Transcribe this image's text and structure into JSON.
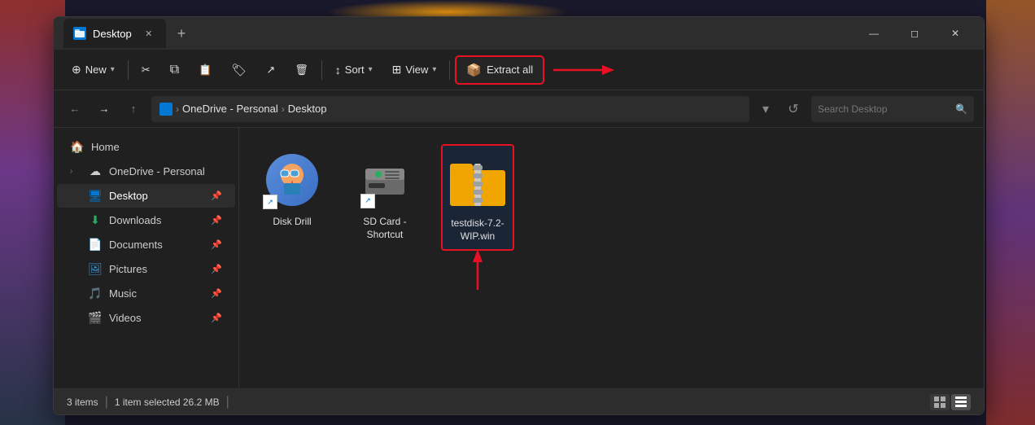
{
  "window": {
    "title": "Desktop",
    "tab_label": "Desktop",
    "new_tab_tooltip": "New tab"
  },
  "toolbar": {
    "new_label": "New",
    "sort_label": "Sort",
    "view_label": "View",
    "extract_all_label": "Extract all",
    "cut_tooltip": "Cut",
    "copy_tooltip": "Copy",
    "paste_tooltip": "Paste",
    "rename_tooltip": "Rename",
    "share_tooltip": "Share",
    "delete_tooltip": "Delete"
  },
  "address_bar": {
    "path_root": "OneDrive - Personal",
    "path_child": "Desktop",
    "search_placeholder": "Search Desktop"
  },
  "sidebar": {
    "items": [
      {
        "label": "Home",
        "icon": "🏠",
        "pinned": false,
        "has_expander": false
      },
      {
        "label": "OneDrive - Personal",
        "icon": "☁",
        "pinned": false,
        "has_expander": true
      },
      {
        "label": "Desktop",
        "icon": "🖥",
        "pinned": true,
        "has_expander": false,
        "active": true
      },
      {
        "label": "Downloads",
        "icon": "⬇",
        "pinned": true,
        "has_expander": false
      },
      {
        "label": "Documents",
        "icon": "📄",
        "pinned": true,
        "has_expander": false
      },
      {
        "label": "Pictures",
        "icon": "🖼",
        "pinned": true,
        "has_expander": false
      },
      {
        "label": "Music",
        "icon": "♪",
        "pinned": true,
        "has_expander": false
      },
      {
        "label": "Videos",
        "icon": "🎬",
        "pinned": true,
        "has_expander": false
      }
    ]
  },
  "files": [
    {
      "name": "Disk Drill",
      "type": "shortcut",
      "selected": false
    },
    {
      "name": "SD Card - Shortcut",
      "type": "drive_shortcut",
      "selected": false
    },
    {
      "name": "testdisk-7.2-WIP.win",
      "type": "zip",
      "selected": true
    }
  ],
  "status_bar": {
    "item_count": "3 items",
    "selected_info": "1 item selected  26.2 MB"
  },
  "colors": {
    "accent": "#0078d4",
    "red_highlight": "#e81123",
    "bg_dark": "#202020",
    "bg_medium": "#2d2d2d",
    "toolbar_border": "#3a3a3a"
  }
}
